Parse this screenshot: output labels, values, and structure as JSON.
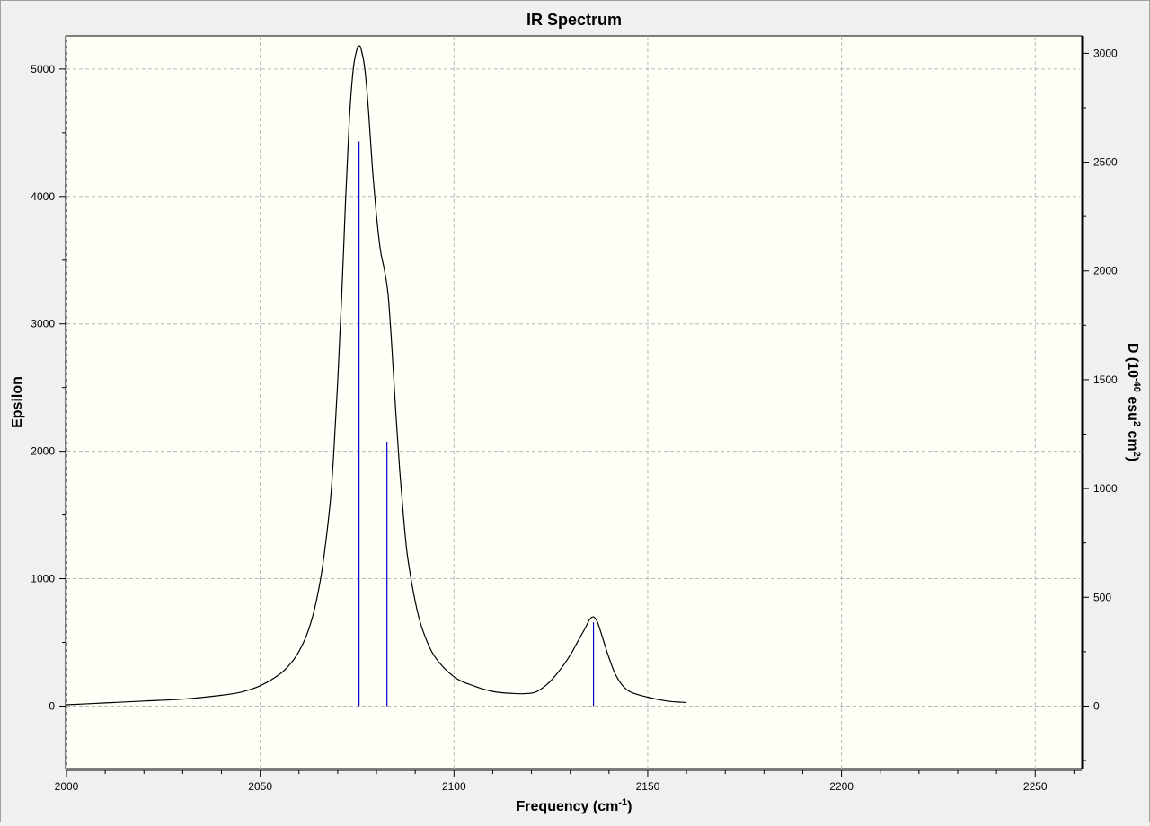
{
  "window": {
    "title": "IR Spectrum"
  },
  "chart_data": {
    "type": "line",
    "title": "IR Spectrum",
    "xlabel": {
      "main": "Frequency (cm",
      "sup": "-1",
      "end": ")"
    },
    "ylabel": "Epsilon",
    "y2label": {
      "a": "D (10",
      "sup1": "-40",
      "b": " esu",
      "sup2": "2",
      "c": " cm",
      "sup3": "2",
      "d": ")"
    },
    "xlim": [
      2000,
      2262
    ],
    "ylim": [
      -490,
      5260
    ],
    "y2lim": [
      -286.9,
      3080
    ],
    "x_ticks": [
      2000,
      2050,
      2100,
      2150,
      2200,
      2250
    ],
    "y_ticks": [
      0,
      1000,
      2000,
      3000,
      4000,
      5000
    ],
    "y2_ticks": [
      0,
      500,
      1000,
      1500,
      2000,
      2500,
      3000
    ],
    "grid": true,
    "colors": {
      "spectrum": "#000000",
      "sticks": "#0000cc",
      "plot_bg": "#fffff8",
      "grid": "#b8b8b8"
    },
    "series": [
      {
        "x": [
          2000,
          2010,
          2020,
          2030,
          2040,
          2045,
          2050,
          2055,
          2058,
          2060,
          2062,
          2064,
          2066,
          2068,
          2069,
          2070,
          2071,
          2072,
          2073,
          2074,
          2075,
          2075.5,
          2076,
          2077,
          2078,
          2079,
          2080,
          2081,
          2082,
          2083,
          2084,
          2085,
          2086,
          2087,
          2088,
          2090,
          2092,
          2095,
          2100,
          2105,
          2110,
          2115,
          2118,
          2121,
          2124,
          2127,
          2130,
          2132,
          2134,
          2135,
          2136,
          2137,
          2138,
          2140,
          2142,
          2145,
          2150,
          2155,
          2160
        ],
        "y": [
          10,
          25,
          40,
          55,
          85,
          110,
          160,
          250,
          340,
          430,
          560,
          760,
          1080,
          1580,
          2000,
          2550,
          3200,
          3950,
          4600,
          5000,
          5160,
          5180,
          5160,
          5000,
          4650,
          4200,
          3850,
          3580,
          3430,
          3230,
          2800,
          2300,
          1850,
          1480,
          1180,
          820,
          590,
          390,
          230,
          160,
          115,
          100,
          98,
          110,
          170,
          270,
          400,
          510,
          620,
          680,
          700,
          660,
          570,
          380,
          230,
          120,
          70,
          40,
          28
        ]
      }
    ],
    "sticks": [
      {
        "x": 2075.5,
        "d": 2595
      },
      {
        "x": 2082.7,
        "d": 1215
      },
      {
        "x": 2136.0,
        "d": 385
      }
    ]
  }
}
